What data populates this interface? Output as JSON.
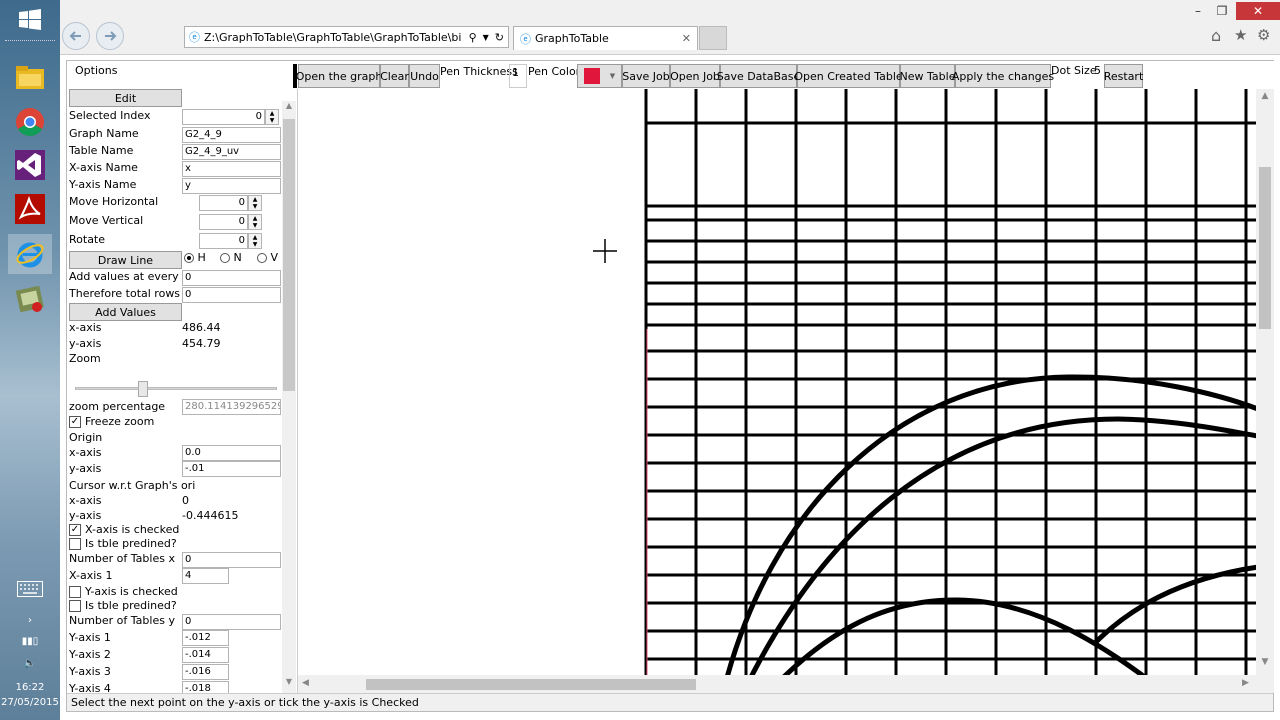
{
  "browser": {
    "address": "Z:\\GraphToTable\\GraphToTable\\GraphToTable\\bi",
    "tab_title": "GraphToTable"
  },
  "taskbar": {
    "time": "16:22",
    "date": "27/05/2015"
  },
  "left_panel": {
    "options_label": "Options",
    "edit_button": "Edit",
    "selected_index_label": "Selected Index",
    "selected_index_value": "0",
    "graph_name_label": "Graph Name",
    "graph_name_value": "G2_4_9",
    "table_name_label": "Table Name",
    "table_name_value": "G2_4_9_uv",
    "x_axis_name_label": "X-axis Name",
    "x_axis_name_value": "x",
    "y_axis_name_label": "Y-axis Name",
    "y_axis_name_value": "y",
    "move_horizontal_label": "Move Horizontal",
    "move_horizontal_value": "0",
    "move_vertical_label": "Move Vertical",
    "move_vertical_value": "0",
    "rotate_label": "Rotate",
    "rotate_value": "0",
    "draw_line_button": "Draw Line",
    "radio_h": "H",
    "radio_n": "N",
    "radio_v": "V",
    "add_values_every_label": "Add values at every",
    "add_values_every_value": "0",
    "total_rows_label": "Therefore total rows",
    "total_rows_value": "0",
    "add_values_button": "Add Values",
    "x_axis_label": "x-axis",
    "x_axis_value": "486.44",
    "y_axis_label": "y-axis",
    "y_axis_value": "454.79",
    "zoom_label": "Zoom",
    "zoom_percentage_label": "zoom percentage",
    "zoom_percentage_value": "280.114139296529",
    "freeze_zoom_label": "Freeze zoom",
    "origin_label": "Origin",
    "origin_x_label": "x-axis",
    "origin_x_value": "0.0",
    "origin_y_label": "y-axis",
    "origin_y_value": "-.01",
    "cursor_label": "Cursor w.r.t Graph's ori",
    "cursor_x_label": "x-axis",
    "cursor_x_value": "0",
    "cursor_y_label": "y-axis",
    "cursor_y_value": "-0.444615",
    "x_checked_label": "X-axis is checked",
    "x_predined_label": "Is tble predined?",
    "num_tables_x_label": "Number of Tables x",
    "num_tables_x_value": "0",
    "x_axis_1_label": "X-axis 1",
    "x_axis_1_value": "4",
    "y_checked_label": "Y-axis is checked",
    "y_predined_label": "Is tble predined?",
    "num_tables_y_label": "Number of Tables y",
    "num_tables_y_value": "0",
    "y_axis_1_label": "Y-axis 1",
    "y_axis_1_value": "-.012",
    "y_axis_2_label": "Y-axis 2",
    "y_axis_2_value": "-.014",
    "y_axis_3_label": "Y-axis 3",
    "y_axis_3_value": "-.016",
    "y_axis_4_label": "Y-axis 4",
    "y_axis_4_value": "-.018"
  },
  "toolbar": {
    "open_graph": "Open the graph",
    "clear": "Clear",
    "undo": "Undo",
    "pen_thickness_label": "Pen Thickness",
    "pen_thickness_value": "1",
    "pen_color_label": "Pen Color",
    "pen_color": "#e0163c",
    "save_job": "Save Job",
    "open_job": "Open Job",
    "save_database": "Save DataBase",
    "open_created_table": "Open Created Table",
    "new_table": "New Table",
    "apply_changes": "Apply the changes",
    "dot_size_label": "Dot Size",
    "dot_size_value": "5",
    "restart": "Restart"
  },
  "status": {
    "message": "Select the next point on the y-axis or tick the y-axis is Checked"
  }
}
